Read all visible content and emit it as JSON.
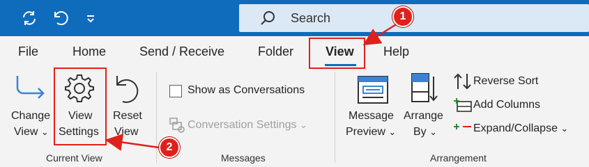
{
  "titlebar": {
    "icons": [
      "refresh-icon",
      "undo-icon",
      "customize-toolbar-icon"
    ],
    "search": {
      "label": "Search"
    }
  },
  "tabs": [
    {
      "label": "File"
    },
    {
      "label": "Home"
    },
    {
      "label": "Send / Receive"
    },
    {
      "label": "Folder"
    },
    {
      "label": "View",
      "selected": true
    },
    {
      "label": "Help"
    }
  ],
  "ribbon": {
    "current_view": {
      "group_label": "Current View",
      "change_view": {
        "line1": "Change",
        "line2": "View",
        "chevron": "⌄"
      },
      "view_settings": {
        "line1": "View",
        "line2": "Settings"
      },
      "reset_view": {
        "line1": "Reset",
        "line2": "View"
      }
    },
    "messages": {
      "group_label": "Messages",
      "show_as_conversations": {
        "label": "Show as Conversations",
        "checked": false
      },
      "conversation_settings": {
        "label": "Conversation Settings",
        "chevron": "⌄",
        "disabled": true
      }
    },
    "arrangement": {
      "group_label": "Arrangement",
      "message_preview": {
        "line1": "Message",
        "line2": "Preview",
        "chevron": "⌄"
      },
      "arrange_by": {
        "line1": "Arrange",
        "line2": "By",
        "chevron": "⌄"
      },
      "reverse_sort": {
        "label": "Reverse Sort"
      },
      "add_columns": {
        "label": "Add Columns"
      },
      "expand_collapse": {
        "label": "Expand/Collapse",
        "chevron": "⌄"
      }
    }
  },
  "annotations": [
    {
      "number": "1"
    },
    {
      "number": "2"
    }
  ],
  "colors": {
    "accent": "#0f6cbd",
    "search_bg": "#dbe8f6",
    "ribbon_bg": "#f3f3f3",
    "annotation_red": "#e0201a"
  }
}
